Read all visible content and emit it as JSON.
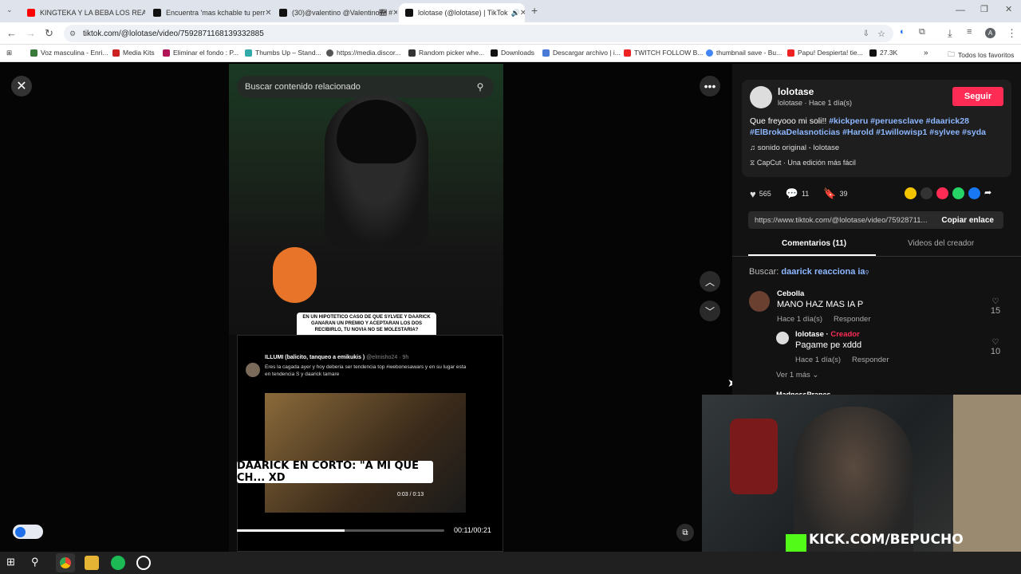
{
  "browser": {
    "tabs": [
      {
        "label": "KINGTEKA Y LA BEBA LOS REAL",
        "color": "#ff0000"
      },
      {
        "label": "Encuentra 'mas kchable tu perr",
        "color": "#111111"
      },
      {
        "label": "(30)@valentino @Valentino🛛 #",
        "color": "#111111"
      },
      {
        "label": "lolotase (@lolotase) | TikTok",
        "color": "#111111"
      }
    ],
    "url": "tiktok.com/@lolotase/video/7592871168139332885",
    "bookmarks": [
      "Voz masculina - Enri...",
      "Media Kits",
      "Eliminar el fondo : P...",
      "Thumbs Up – Stand...",
      "https://media.discor...",
      "Random picker whe...",
      "Downloads",
      "Descargar archivo | i...",
      "TWITCH FOLLOW B...",
      "thumbnail save - Bu...",
      "Papu! Despierta! tie...",
      "27.3K"
    ],
    "all_bookmarks": "Todos los favoritos"
  },
  "video": {
    "search_placeholder": "Buscar contenido relacionado",
    "banner_top": "EN UN HIPOTETICO CASO DE QUE SYLVEE Y DAARICK GANARAN UN PREMIO Y ACEPTARAN LOS DOS RECIBIRLO, TU NOVIA NO SE MOLESTARIA?",
    "tweet_author": "ILLUMI (balicito, tanqueo a emikukis )",
    "tweet_handle": "@elmisho24 · 9h",
    "tweet_text": "Eres la cagada ayer y hoy deberia ser tendencia top #webonesawars y en su lugar esta en tendencia S y daarick tamare",
    "banner_bottom": "DAARICK EN CORTO: \"A MI QUE CH... XD",
    "inner_time": "0:03 / 0:13",
    "timecode": "00:11/00:21",
    "progress": 0.52
  },
  "post": {
    "username": "lolotase",
    "subline": "lolotase · Hace 1 día(s)",
    "follow_label": "Seguir",
    "caption_text": "Que freyooo mi soli!!",
    "hashtags": [
      "#kickperu",
      "#peruesclave",
      "#daarick28",
      "#ElBrokaDelasnoticias",
      "#Harold",
      "#1willowisp1",
      "#sylvee",
      "#syda"
    ],
    "sound": "sonido original - lolotase",
    "capcut": "CapCut · Una edición más fácil",
    "likes": "565",
    "comments": "11",
    "saves": "39",
    "link": "https://www.tiktok.com/@lolotase/video/75928711...",
    "copy_label": "Copiar enlace",
    "tab_comments": "Comentarios (11)",
    "tab_videos": "Videos del creador",
    "search_prefix": "Buscar:",
    "search_query": "daarick reacciona ia"
  },
  "comments": [
    {
      "name": "Cebolla",
      "text": "MANO HAZ MAS IA P",
      "time": "Hace 1 día(s)",
      "reply": "Responder",
      "likes": "15"
    },
    {
      "name": "lolotase",
      "creator": "Creador",
      "text": "Pagame pe xddd",
      "time": "Hace 1 día(s)",
      "reply": "Responder",
      "likes": "10"
    }
  ],
  "more_replies": "Ver 1 más",
  "next_comment_name": "MadnessPranes",
  "stream_overlay": "KICK.COM/BEPUCHO",
  "colors": {
    "accent": "#fe2c55",
    "hashtag": "#8db7ff",
    "kick": "#53fc18"
  }
}
